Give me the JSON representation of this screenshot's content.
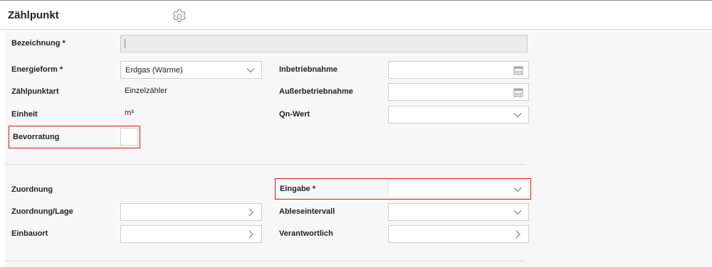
{
  "header": {
    "title": "Zählpunkt"
  },
  "form": {
    "bezeichnung": {
      "label": "Bezeichnung *",
      "value": ""
    },
    "energieform": {
      "label": "Energieform *",
      "value": "Erdgas (Wärme)"
    },
    "zaehlpunktart": {
      "label": "Zählpunktart",
      "value": "Einzelzähler"
    },
    "einheit": {
      "label": "Einheit",
      "value": "m³"
    },
    "bevorratung": {
      "label": "Bevorratung",
      "checked": false
    },
    "inbetriebnahme": {
      "label": "Inbetriebnahme",
      "value": ""
    },
    "ausserbetriebnahme": {
      "label": "Außerbetriebnahme",
      "value": ""
    },
    "qn_wert": {
      "label": "Qn-Wert",
      "value": ""
    },
    "zuordnung": {
      "label": "Zuordnung"
    },
    "zuordnung_lage": {
      "label": "Zuordnung/Lage",
      "value": ""
    },
    "einbauort": {
      "label": "Einbauort",
      "value": ""
    },
    "eingabe": {
      "label": "Eingabe *",
      "value": ""
    },
    "ableseintervall": {
      "label": "Ableseintervall",
      "value": ""
    },
    "verantwortlich": {
      "label": "Verantwortlich",
      "value": ""
    }
  },
  "colors": {
    "highlight": "#e0141e",
    "panel": "#f7f7f7",
    "disabled_field": "#ececec"
  },
  "icons": {
    "settings": "gear-icon",
    "dropdown": "chevron-down-icon",
    "navigate": "chevron-right-icon",
    "date": "calendar-icon"
  }
}
